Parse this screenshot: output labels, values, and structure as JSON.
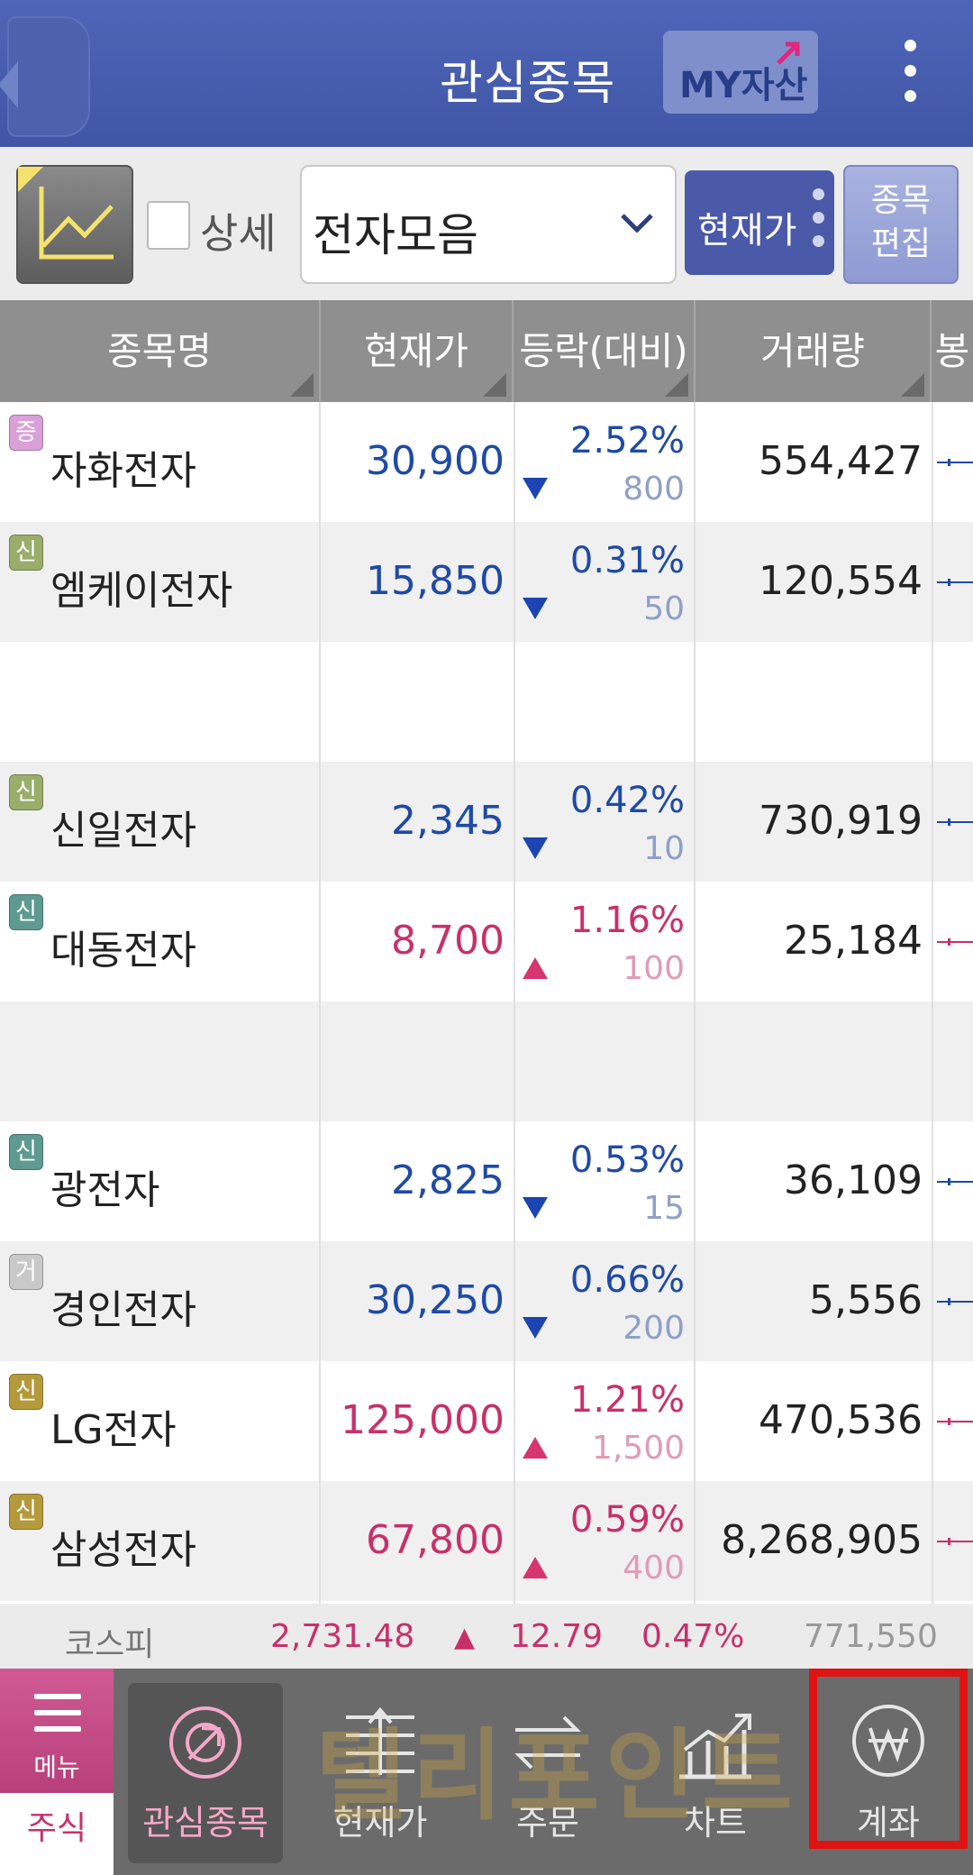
{
  "header": {
    "title": "관심종목",
    "my_badge": "MY자산"
  },
  "toolbar": {
    "detail_label": "상세",
    "group_select": "전자모음",
    "view_button": "현재가",
    "edit_button_line1": "종목",
    "edit_button_line2": "편집"
  },
  "table": {
    "columns": [
      "종목명",
      "현재가",
      "등락(대비)",
      "거래량",
      "봉"
    ],
    "rows": [
      {
        "badge": "증",
        "badge_color": "#d9a0d9",
        "name": "자화전자",
        "price": "30,900",
        "pct": "2.52%",
        "diff": "800",
        "dir": "down",
        "volume": "554,427"
      },
      {
        "badge": "신",
        "badge_color": "#9aad6a",
        "name": "엠케이전자",
        "price": "15,850",
        "pct": "0.31%",
        "diff": "50",
        "dir": "down",
        "volume": "120,554"
      },
      {
        "badge": "",
        "name": "",
        "price": "",
        "pct": "",
        "diff": "",
        "dir": "",
        "volume": ""
      },
      {
        "badge": "신",
        "badge_color": "#9aad6a",
        "name": "신일전자",
        "price": "2,345",
        "pct": "0.42%",
        "diff": "10",
        "dir": "down",
        "volume": "730,919"
      },
      {
        "badge": "신",
        "badge_color": "#5f9a90",
        "name": "대동전자",
        "price": "8,700",
        "pct": "1.16%",
        "diff": "100",
        "dir": "up",
        "volume": "25,184"
      },
      {
        "badge": "",
        "name": "",
        "price": "",
        "pct": "",
        "diff": "",
        "dir": "",
        "volume": ""
      },
      {
        "badge": "신",
        "badge_color": "#5f9a90",
        "name": "광전자",
        "price": "2,825",
        "pct": "0.53%",
        "diff": "15",
        "dir": "down",
        "volume": "36,109"
      },
      {
        "badge": "거",
        "badge_color": "#c9c9c9",
        "name": "경인전자",
        "price": "30,250",
        "pct": "0.66%",
        "diff": "200",
        "dir": "down",
        "volume": "5,556"
      },
      {
        "badge": "신",
        "badge_color": "#b59a3c",
        "name": "LG전자",
        "price": "125,000",
        "pct": "1.21%",
        "diff": "1,500",
        "dir": "up",
        "volume": "470,536"
      },
      {
        "badge": "신",
        "badge_color": "#b59a3c",
        "name": "삼성전자",
        "price": "67,800",
        "pct": "0.59%",
        "diff": "400",
        "dir": "up",
        "volume": "8,268,905"
      }
    ]
  },
  "index_bar": {
    "name": "코스피",
    "value": "2,731.48",
    "arrow": "▲",
    "change": "12.79",
    "pct": "0.47%",
    "volume": "771,550"
  },
  "bottom_nav": {
    "menu_label": "메뉴",
    "stock_tab": "주식",
    "items": [
      "관심종목",
      "현재가",
      "주문",
      "차트",
      "계좌"
    ]
  },
  "watermark": "텔리포인트",
  "colors": {
    "up": "#c8306a",
    "down": "#1f4aa6",
    "header_bar": "#4f66b8",
    "highlight": "#e01212"
  }
}
